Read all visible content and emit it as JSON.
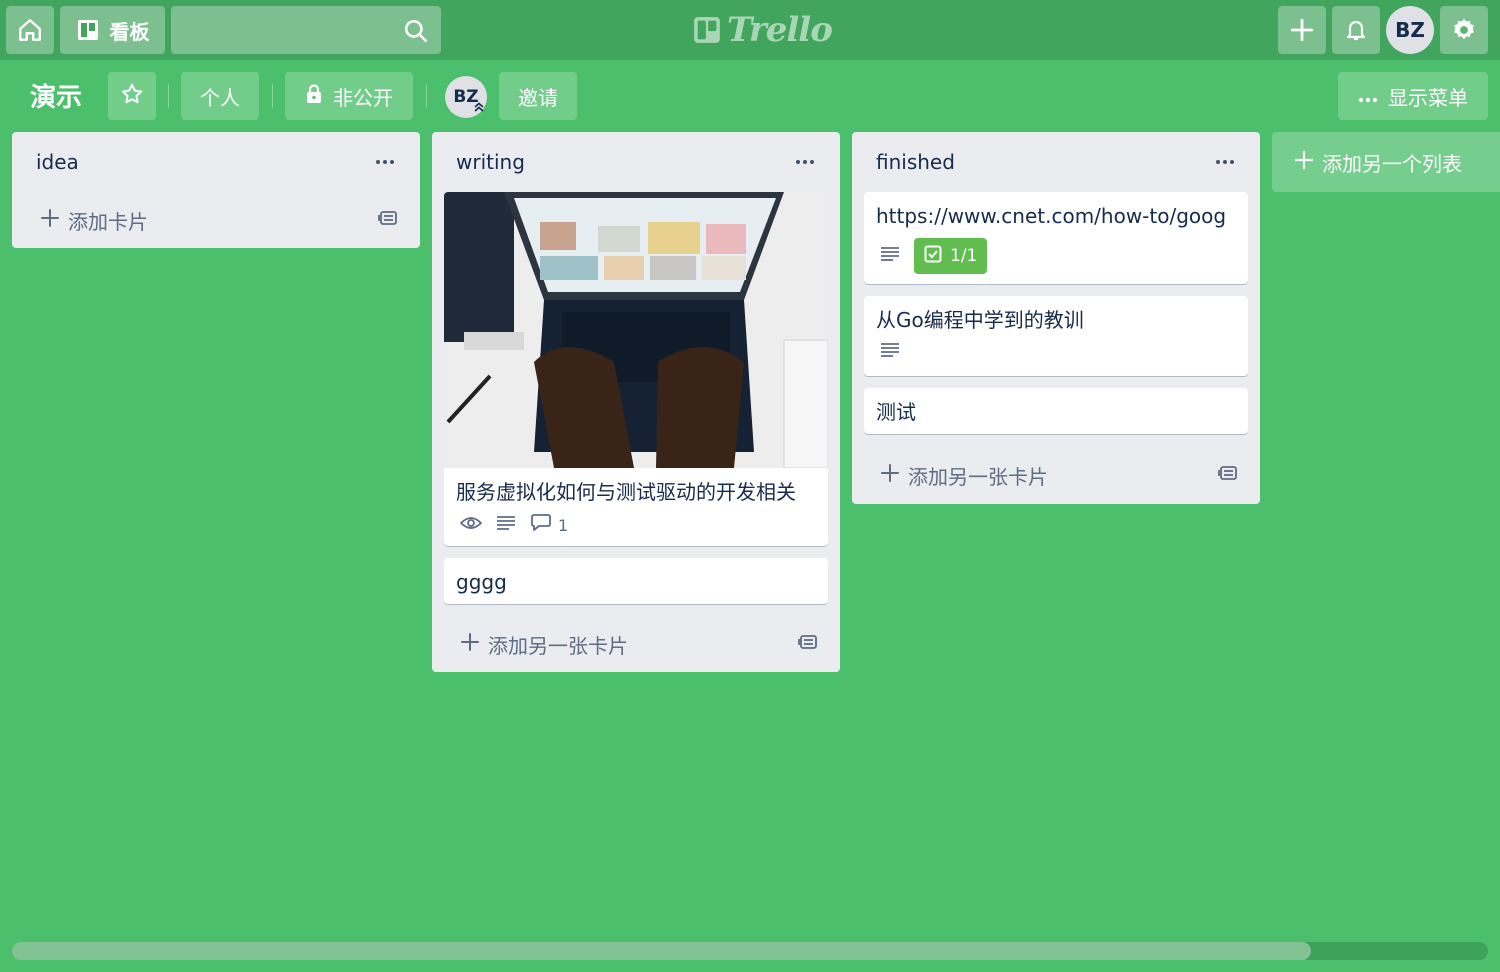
{
  "header": {
    "boards_label": "看板",
    "search": {
      "value": "",
      "placeholder": ""
    },
    "logo_text": "Trello",
    "user_initials": "BZ"
  },
  "board": {
    "title": "演示",
    "team_label": "个人",
    "visibility_label": "非公开",
    "member_initials": "BZ",
    "invite_label": "邀请",
    "show_menu_label": "显示菜单"
  },
  "lists": [
    {
      "title": "idea",
      "cards": [],
      "add_label": "添加卡片"
    },
    {
      "title": "writing",
      "cards": [
        {
          "title": "服务虚拟化如何与测试驱动的开发相关",
          "has_cover": true,
          "comments": "1"
        },
        {
          "title": "gggg"
        }
      ],
      "add_label": "添加另一张卡片"
    },
    {
      "title": "finished",
      "cards": [
        {
          "title": "https://www.cnet.com/how-to/goog",
          "checklist": "1/1"
        },
        {
          "title": "从Go编程中学到的教训"
        },
        {
          "title": "测试"
        }
      ],
      "add_label": "添加另一张卡片"
    }
  ],
  "add_list_label": "添加另一个列表",
  "colors": {
    "board_bg": "#4bbf6b",
    "header_bg": "#42a55d",
    "list_bg": "#ebecf0",
    "checklist_done": "#61bd4f"
  },
  "scroll": {
    "position_fraction": 0.88
  }
}
